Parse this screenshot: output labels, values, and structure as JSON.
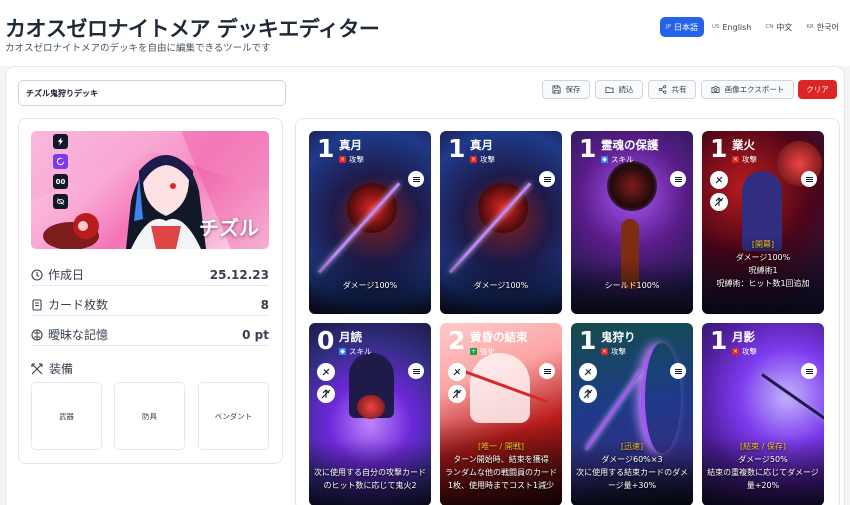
{
  "header": {
    "title": "カオスゼロナイトメア デッキエディター",
    "subtitle": "カオスゼロナイトメアのデッキを自由に編集できるツールです"
  },
  "languages": [
    {
      "code": "JP",
      "label": "日本語",
      "active": true
    },
    {
      "code": "US",
      "label": "English",
      "active": false
    },
    {
      "code": "CN",
      "label": "中文",
      "active": false
    },
    {
      "code": "KR",
      "label": "한국어",
      "active": false
    }
  ],
  "deck": {
    "name": "チズル鬼狩りデッキ"
  },
  "toolbar": {
    "save": "保存",
    "load": "読込",
    "share": "共有",
    "export_image": "画像エクスポート",
    "clear": "クリア"
  },
  "character": {
    "name": "チズル",
    "icon_badge_text": "00"
  },
  "stats": {
    "created_label": "作成日",
    "created_value": "25.12.23",
    "card_count_label": "カード枚数",
    "card_count_value": "8",
    "memory_label": "曖昧な記憶",
    "memory_value": "0 pt"
  },
  "equipment": {
    "title": "装備",
    "weapon": "武器",
    "armor": "防具",
    "pendant": "ペンダント"
  },
  "cards": [
    {
      "cost": "1",
      "name": "真月",
      "type": "攻撃",
      "tag": "",
      "desc": "ダメージ100%"
    },
    {
      "cost": "1",
      "name": "真月",
      "type": "攻撃",
      "tag": "",
      "desc": "ダメージ100%"
    },
    {
      "cost": "1",
      "name": "霊魂の保護",
      "type": "スキル",
      "tag": "",
      "desc": "シールド100%"
    },
    {
      "cost": "1",
      "name": "業火",
      "type": "攻撃",
      "tag": "[開幕]",
      "desc": "ダメージ100%\n呪縛術1\n呪縛術：ヒット数1回追加"
    },
    {
      "cost": "0",
      "name": "月読",
      "type": "スキル",
      "tag": "",
      "desc": "次に使用する自分の攻撃カードのヒット数に応じて鬼火2"
    },
    {
      "cost": "2",
      "name": "黄昏の結束",
      "type": "強化",
      "tag": "[唯一 / 開戦]",
      "desc": "ターン開始時、結束を獲得\nランダムな他の戦闘員のカード1枚、使用時までコスト1減少"
    },
    {
      "cost": "1",
      "name": "鬼狩り",
      "type": "攻撃",
      "tag": "[迅速]",
      "desc": "ダメージ60%×3\n次に使用する結束カードのダメージ量+30%"
    },
    {
      "cost": "1",
      "name": "月影",
      "type": "攻撃",
      "tag": "[結束 / 保存]",
      "desc": "ダメージ50%\n結束の重複数に応じてダメージ量+20%"
    }
  ],
  "colors": {
    "accent": "#2563eb",
    "danger": "#dc2626",
    "attack": "#dc2626",
    "skill": "#3b82f6",
    "buff": "#16a34a"
  }
}
